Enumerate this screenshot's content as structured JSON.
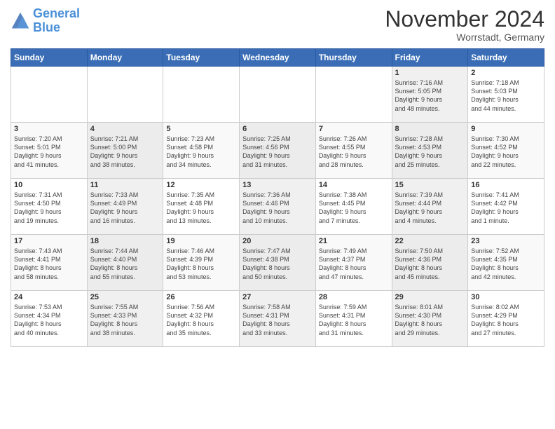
{
  "header": {
    "logo_line1": "General",
    "logo_line2": "Blue",
    "month_title": "November 2024",
    "location": "Worrstadt, Germany"
  },
  "days_of_week": [
    "Sunday",
    "Monday",
    "Tuesday",
    "Wednesday",
    "Thursday",
    "Friday",
    "Saturday"
  ],
  "weeks": [
    {
      "days": [
        {
          "num": "",
          "info": ""
        },
        {
          "num": "",
          "info": ""
        },
        {
          "num": "",
          "info": ""
        },
        {
          "num": "",
          "info": ""
        },
        {
          "num": "",
          "info": ""
        },
        {
          "num": "1",
          "info": "Sunrise: 7:16 AM\nSunset: 5:05 PM\nDaylight: 9 hours\nand 48 minutes."
        },
        {
          "num": "2",
          "info": "Sunrise: 7:18 AM\nSunset: 5:03 PM\nDaylight: 9 hours\nand 44 minutes."
        }
      ]
    },
    {
      "days": [
        {
          "num": "3",
          "info": "Sunrise: 7:20 AM\nSunset: 5:01 PM\nDaylight: 9 hours\nand 41 minutes."
        },
        {
          "num": "4",
          "info": "Sunrise: 7:21 AM\nSunset: 5:00 PM\nDaylight: 9 hours\nand 38 minutes."
        },
        {
          "num": "5",
          "info": "Sunrise: 7:23 AM\nSunset: 4:58 PM\nDaylight: 9 hours\nand 34 minutes."
        },
        {
          "num": "6",
          "info": "Sunrise: 7:25 AM\nSunset: 4:56 PM\nDaylight: 9 hours\nand 31 minutes."
        },
        {
          "num": "7",
          "info": "Sunrise: 7:26 AM\nSunset: 4:55 PM\nDaylight: 9 hours\nand 28 minutes."
        },
        {
          "num": "8",
          "info": "Sunrise: 7:28 AM\nSunset: 4:53 PM\nDaylight: 9 hours\nand 25 minutes."
        },
        {
          "num": "9",
          "info": "Sunrise: 7:30 AM\nSunset: 4:52 PM\nDaylight: 9 hours\nand 22 minutes."
        }
      ]
    },
    {
      "days": [
        {
          "num": "10",
          "info": "Sunrise: 7:31 AM\nSunset: 4:50 PM\nDaylight: 9 hours\nand 19 minutes."
        },
        {
          "num": "11",
          "info": "Sunrise: 7:33 AM\nSunset: 4:49 PM\nDaylight: 9 hours\nand 16 minutes."
        },
        {
          "num": "12",
          "info": "Sunrise: 7:35 AM\nSunset: 4:48 PM\nDaylight: 9 hours\nand 13 minutes."
        },
        {
          "num": "13",
          "info": "Sunrise: 7:36 AM\nSunset: 4:46 PM\nDaylight: 9 hours\nand 10 minutes."
        },
        {
          "num": "14",
          "info": "Sunrise: 7:38 AM\nSunset: 4:45 PM\nDaylight: 9 hours\nand 7 minutes."
        },
        {
          "num": "15",
          "info": "Sunrise: 7:39 AM\nSunset: 4:44 PM\nDaylight: 9 hours\nand 4 minutes."
        },
        {
          "num": "16",
          "info": "Sunrise: 7:41 AM\nSunset: 4:42 PM\nDaylight: 9 hours\nand 1 minute."
        }
      ]
    },
    {
      "days": [
        {
          "num": "17",
          "info": "Sunrise: 7:43 AM\nSunset: 4:41 PM\nDaylight: 8 hours\nand 58 minutes."
        },
        {
          "num": "18",
          "info": "Sunrise: 7:44 AM\nSunset: 4:40 PM\nDaylight: 8 hours\nand 55 minutes."
        },
        {
          "num": "19",
          "info": "Sunrise: 7:46 AM\nSunset: 4:39 PM\nDaylight: 8 hours\nand 53 minutes."
        },
        {
          "num": "20",
          "info": "Sunrise: 7:47 AM\nSunset: 4:38 PM\nDaylight: 8 hours\nand 50 minutes."
        },
        {
          "num": "21",
          "info": "Sunrise: 7:49 AM\nSunset: 4:37 PM\nDaylight: 8 hours\nand 47 minutes."
        },
        {
          "num": "22",
          "info": "Sunrise: 7:50 AM\nSunset: 4:36 PM\nDaylight: 8 hours\nand 45 minutes."
        },
        {
          "num": "23",
          "info": "Sunrise: 7:52 AM\nSunset: 4:35 PM\nDaylight: 8 hours\nand 42 minutes."
        }
      ]
    },
    {
      "days": [
        {
          "num": "24",
          "info": "Sunrise: 7:53 AM\nSunset: 4:34 PM\nDaylight: 8 hours\nand 40 minutes."
        },
        {
          "num": "25",
          "info": "Sunrise: 7:55 AM\nSunset: 4:33 PM\nDaylight: 8 hours\nand 38 minutes."
        },
        {
          "num": "26",
          "info": "Sunrise: 7:56 AM\nSunset: 4:32 PM\nDaylight: 8 hours\nand 35 minutes."
        },
        {
          "num": "27",
          "info": "Sunrise: 7:58 AM\nSunset: 4:31 PM\nDaylight: 8 hours\nand 33 minutes."
        },
        {
          "num": "28",
          "info": "Sunrise: 7:59 AM\nSunset: 4:31 PM\nDaylight: 8 hours\nand 31 minutes."
        },
        {
          "num": "29",
          "info": "Sunrise: 8:01 AM\nSunset: 4:30 PM\nDaylight: 8 hours\nand 29 minutes."
        },
        {
          "num": "30",
          "info": "Sunrise: 8:02 AM\nSunset: 4:29 PM\nDaylight: 8 hours\nand 27 minutes."
        }
      ]
    }
  ]
}
